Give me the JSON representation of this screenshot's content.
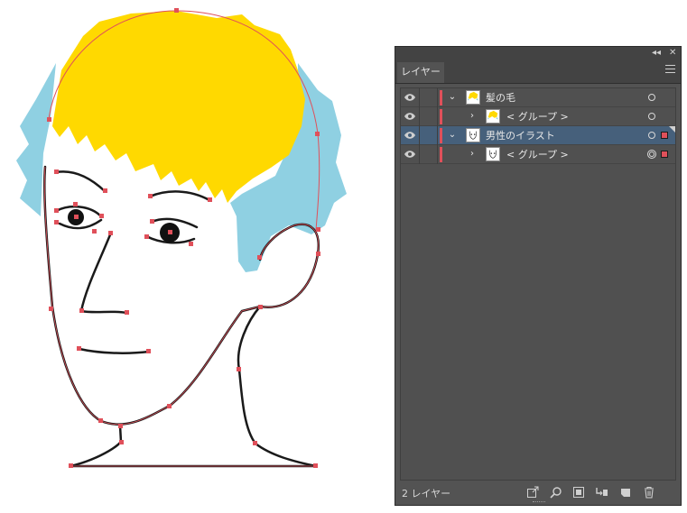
{
  "artwork": {
    "hair_color": "#ffd900",
    "hair_shadow_color": "#8fd0e2",
    "path_color": "#e0505a",
    "stroke_color": "#1a1a1a"
  },
  "layers_panel": {
    "tab_label": "レイヤー",
    "collapse_label": "◂◂",
    "close_label": "✕",
    "rows": [
      {
        "label": "髪の毛",
        "thumb_icon": "hair-thumbnail"
      },
      {
        "label": "< グループ >",
        "thumb_icon": "hair-thumbnail"
      },
      {
        "label": "男性のイラスト",
        "thumb_icon": "face-thumbnail"
      },
      {
        "label": "< グループ >",
        "thumb_icon": "face-thumbnail"
      }
    ],
    "layer_count": "2 レイヤー",
    "footer_icons": [
      "export-icon",
      "locate-object-icon",
      "clipping-mask-icon",
      "new-sublayer-icon",
      "new-layer-icon",
      "trash-icon"
    ],
    "selection_color": "#46607b",
    "layer_color": "#e0505a"
  }
}
